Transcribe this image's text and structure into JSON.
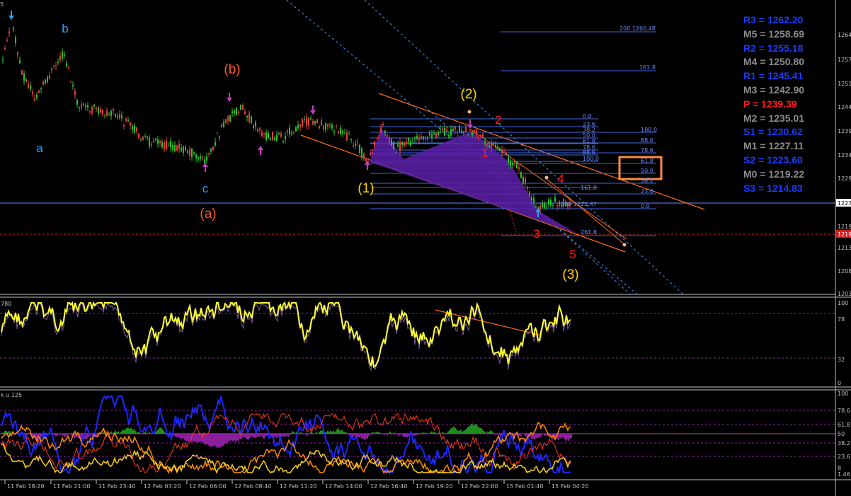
{
  "colors": {
    "background": "#000000",
    "grid": "#c0c0c0",
    "bull_candle": "#27c427",
    "bear_candle": "#e33d3d",
    "wave_blue": "#2aa0ff",
    "wave_orange": "#ff5a2a",
    "wave_yellow": "#ffd700",
    "wave_red": "#ff1a1a",
    "fib_line": "#4169e1",
    "channel": "#ff6a1a",
    "pattern_fill": "#5a1fa8",
    "osc_yellow": "#ffff33",
    "osc_blue": "#1b28ff",
    "osc_orange": "#ff8c00",
    "hist_green": "#1f8c1f",
    "hist_purple": "#8a1f9c",
    "highlight_box": "#ff8c40"
  },
  "header": {
    "timeframe_label": "5"
  },
  "pivots": [
    {
      "label": "R3",
      "value": "1262.20",
      "color": "#1a3cff"
    },
    {
      "label": "M5",
      "value": "1258.69",
      "color": "#8c8c8c"
    },
    {
      "label": "R2",
      "value": "1255.18",
      "color": "#1a3cff"
    },
    {
      "label": "M4",
      "value": "1250.80",
      "color": "#8c8c8c"
    },
    {
      "label": "R1",
      "value": "1245.41",
      "color": "#1a3cff"
    },
    {
      "label": "M3",
      "value": "1242.90",
      "color": "#8c8c8c"
    },
    {
      "label": "P",
      "value": "1239.39",
      "color": "#ff1a1a"
    },
    {
      "label": "M2",
      "value": "1235.01",
      "color": "#8c8c8c"
    },
    {
      "label": "S1",
      "value": "1230.62",
      "color": "#1a3cff"
    },
    {
      "label": "M1",
      "value": "1227.11",
      "color": "#8c8c8c"
    },
    {
      "label": "S2",
      "value": "1223.60",
      "color": "#1a3cff"
    },
    {
      "label": "M0",
      "value": "1219.22",
      "color": "#8c8c8c"
    },
    {
      "label": "S3",
      "value": "1214.83",
      "color": "#1a3cff"
    }
  ],
  "price_scale_labels": [
    "1264",
    "1257",
    "1251",
    "1244",
    "1239",
    "1234",
    "1229",
    "1223",
    "1219",
    "1213",
    "1208",
    "1203"
  ],
  "current_price_tag": "1223",
  "dashed_level_tag": "1219",
  "wave_labels": {
    "blue": [
      "b",
      "a",
      "c"
    ],
    "orange": [
      "(b)",
      "(a)"
    ],
    "yellow": [
      "(2)",
      "(1)",
      "(3)"
    ],
    "red": [
      "2",
      "1",
      "4",
      "3",
      "5"
    ]
  },
  "fib_labels": {
    "ext_top": "200 1260.48",
    "ext_1618": "161.8",
    "retr_left": [
      "0.0",
      "23.6",
      "38.2",
      "50.0",
      "61.8",
      "78.6",
      "88.6",
      "100.0"
    ],
    "retr_right": [
      "100.0",
      "88.6",
      "78.6",
      "61.8",
      "50.0",
      "38.2",
      "23.6",
      "0.0"
    ],
    "ext_mid": "161.8",
    "ext_200": "200 1222.47",
    "ext_2618": "261.8"
  },
  "oscillator1": {
    "title": "780",
    "scale": [
      "100",
      "78",
      "32",
      "0"
    ]
  },
  "oscillator2": {
    "title": "k u 125",
    "scale": [
      "100",
      "78.6",
      "61.8",
      "50",
      "38.2",
      "23.6",
      "8",
      "1.46"
    ]
  },
  "time_axis": [
    "11 Feb 18:20",
    "11 Feb 21:00",
    "11 Feb 23:40",
    "12 Feb 03:20",
    "12 Feb 06:00",
    "12 Feb 08:40",
    "12 Feb 11:20",
    "12 Feb 14:00",
    "12 Feb 16:40",
    "12 Feb 19:20",
    "12 Feb 22:00",
    "15 Feb 01:40",
    "15 Feb 04:20"
  ]
}
